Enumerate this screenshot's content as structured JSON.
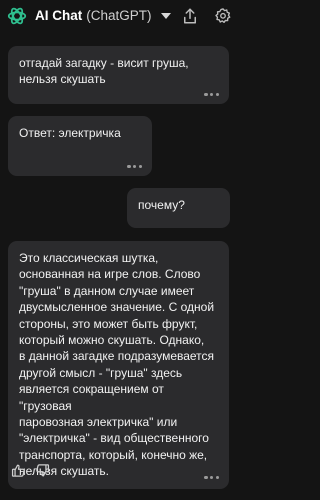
{
  "header": {
    "app_name": "AI Chat",
    "model_name": "(ChatGPT)",
    "logo_icon": "openai-logo",
    "dropdown_icon": "chevron-down",
    "share_icon": "share",
    "settings_icon": "gear"
  },
  "messages": [
    {
      "role": "user",
      "text": "отгадай загадку - висит груша,\nнельзя скушать"
    },
    {
      "role": "assistant",
      "text": "Ответ: электричка"
    },
    {
      "role": "user",
      "text": "почему?"
    },
    {
      "role": "assistant",
      "text": "Это классическая шутка,\nоснованная на игре слов. Слово\n\"груша\" в данном случае имеет\nдвусмысленное значение. С одной\nстороны, это может быть фрукт,\nкоторый можно скушать. Однако,\nв данной загадке подразумевается\nдругой смысл - \"груша\" здесь\nявляется сокращением от \"грузовая\nпаровозная электричка\" или\n\"электричка\" - вид общественного\nтранспорта, который, конечно же,\nнельзя скушать."
    }
  ],
  "colors": {
    "background": "#141414",
    "bubble": "#2b2b2d",
    "text": "#f2f2f2",
    "icon": "#bdbdbd"
  }
}
